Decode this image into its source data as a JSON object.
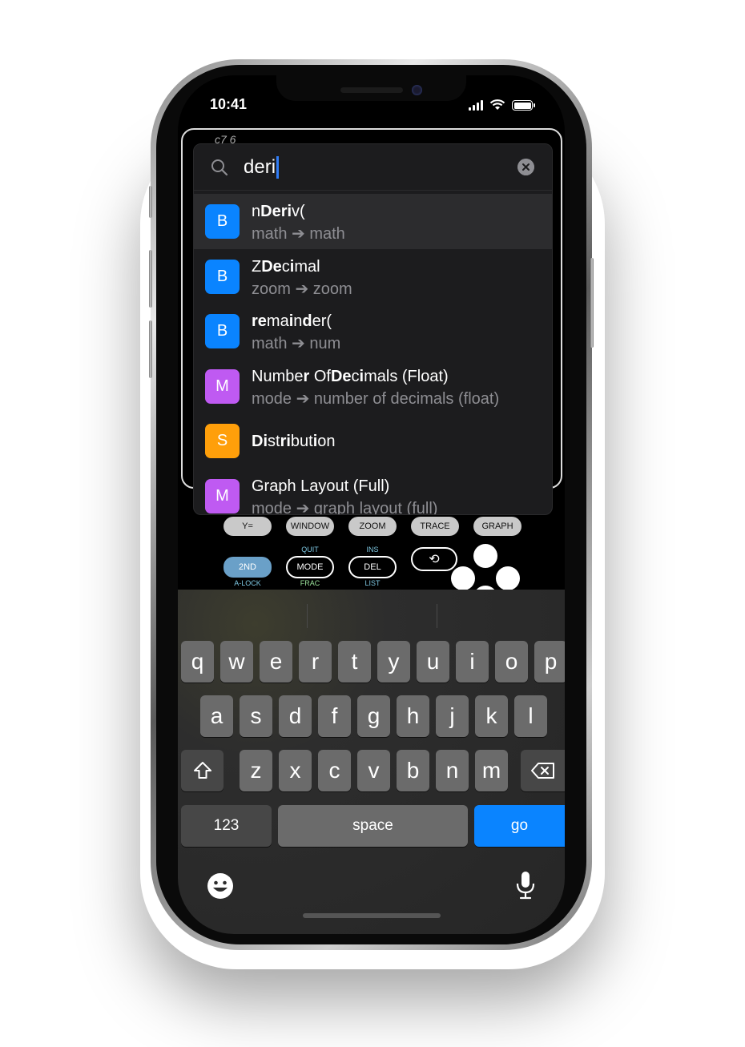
{
  "status_bar": {
    "time": "10:41"
  },
  "calc_display": {
    "fragment": "c7 6"
  },
  "search": {
    "query": "deri"
  },
  "results": [
    {
      "badge": "B",
      "badge_color": "#0a84ff",
      "title_html": "n<b>Deri</b>v(",
      "subtitle": "math ➔ math",
      "selected": true
    },
    {
      "badge": "B",
      "badge_color": "#0a84ff",
      "title_html": "Z<b>De</b>c<b>i</b>mal",
      "subtitle": "zoom ➔ zoom",
      "selected": false
    },
    {
      "badge": "B",
      "badge_color": "#0a84ff",
      "title_html": "<b>re</b>ma<b>i</b>n<b>d</b>er(",
      "subtitle": "math ➔ num",
      "selected": false
    },
    {
      "badge": "M",
      "badge_color": "#bf5af2",
      "title_html": "Numbe<b>r</b> Of<b>De</b>c<b>i</b>mals (Float)",
      "subtitle": "mode ➔ number of decimals (float)",
      "selected": false
    },
    {
      "badge": "S",
      "badge_color": "#ff9f0a",
      "title_html": "<b>Di</b>st<b>ri</b>but<b>i</b>on",
      "subtitle": "",
      "selected": false
    },
    {
      "badge": "M",
      "badge_color": "#bf5af2",
      "title_html": "Graph Layout (Full)",
      "subtitle": "mode ➔ graph layout (full)",
      "selected": false
    }
  ],
  "calc_keys": {
    "row1": [
      "Y=",
      "WINDOW",
      "ZOOM",
      "TRACE",
      "GRAPH"
    ],
    "second": "2ND",
    "second_sub": "A-LOCK",
    "mode": "MODE",
    "mode_top": "QUIT",
    "mode_sub": "FRAC",
    "del": "DEL",
    "del_top": "INS",
    "del_sub": "LIST",
    "enter_icon": "⟲"
  },
  "keyboard": {
    "row1": [
      "q",
      "w",
      "e",
      "r",
      "t",
      "y",
      "u",
      "i",
      "o",
      "p"
    ],
    "row2": [
      "a",
      "s",
      "d",
      "f",
      "g",
      "h",
      "j",
      "k",
      "l"
    ],
    "row3": [
      "z",
      "x",
      "c",
      "v",
      "b",
      "n",
      "m"
    ],
    "numbers_key": "123",
    "space_key": "space",
    "go_key": "go",
    "shift_icon": "shift-icon",
    "delete_icon": "delete-icon",
    "emoji_icon": "emoji-icon",
    "mic_icon": "microphone-icon"
  },
  "colors": {
    "accent": "#0a84ff",
    "math_badge": "#0a84ff",
    "mode_badge": "#bf5af2",
    "stat_badge": "#ff9f0a"
  }
}
